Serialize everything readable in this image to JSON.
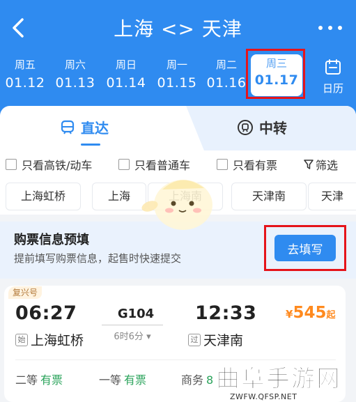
{
  "header": {
    "title": "上海 <> 天津",
    "back_icon": "chevron-left-icon",
    "more_icon": "more-dots-icon",
    "calendar_label": "日历",
    "calendar_icon": "calendar-icon"
  },
  "dates": [
    {
      "weekday": "周五",
      "date": "01.12"
    },
    {
      "weekday": "周六",
      "date": "01.13"
    },
    {
      "weekday": "周日",
      "date": "01.14"
    },
    {
      "weekday": "周一",
      "date": "01.15"
    },
    {
      "weekday": "周二",
      "date": "01.16"
    },
    {
      "weekday": "周三",
      "date": "01.17",
      "selected": true
    }
  ],
  "tabs": [
    {
      "label": "直达",
      "icon": "train-icon",
      "active": true
    },
    {
      "label": "中转",
      "icon": "transfer-icon",
      "active": false
    }
  ],
  "filters": [
    "只看高铁/动车",
    "只看普通车",
    "只看有票",
    "筛选"
  ],
  "stations": [
    "上海虹桥",
    "上海",
    "上海南",
    "天津南",
    "天津"
  ],
  "prefill": {
    "title": "购票信息预填",
    "subtitle": "提前填写购票信息，起售时快速提交",
    "button": "去填写"
  },
  "train": {
    "tag": "复兴号",
    "depart_time": "06:27",
    "train_no": "G104",
    "arrive_time": "12:33",
    "duration": "6时6分",
    "price_symbol": "¥",
    "price": "545",
    "price_suffix": "起",
    "from_badge": "始",
    "from": "上海虹桥",
    "to_badge": "过",
    "to": "天津南",
    "seats": [
      {
        "class": "二等",
        "status": "有票"
      },
      {
        "class": "一等",
        "status": "有票"
      },
      {
        "class": "商务",
        "status": "8"
      }
    ]
  },
  "watermark": {
    "text": "曲阜手游网",
    "url": "ZWFW.QFSP.NET"
  },
  "colors": {
    "primary": "#2f8bf0",
    "highlight_box": "#e5141b",
    "price": "#ff8a1f",
    "available": "#2aa35b"
  }
}
